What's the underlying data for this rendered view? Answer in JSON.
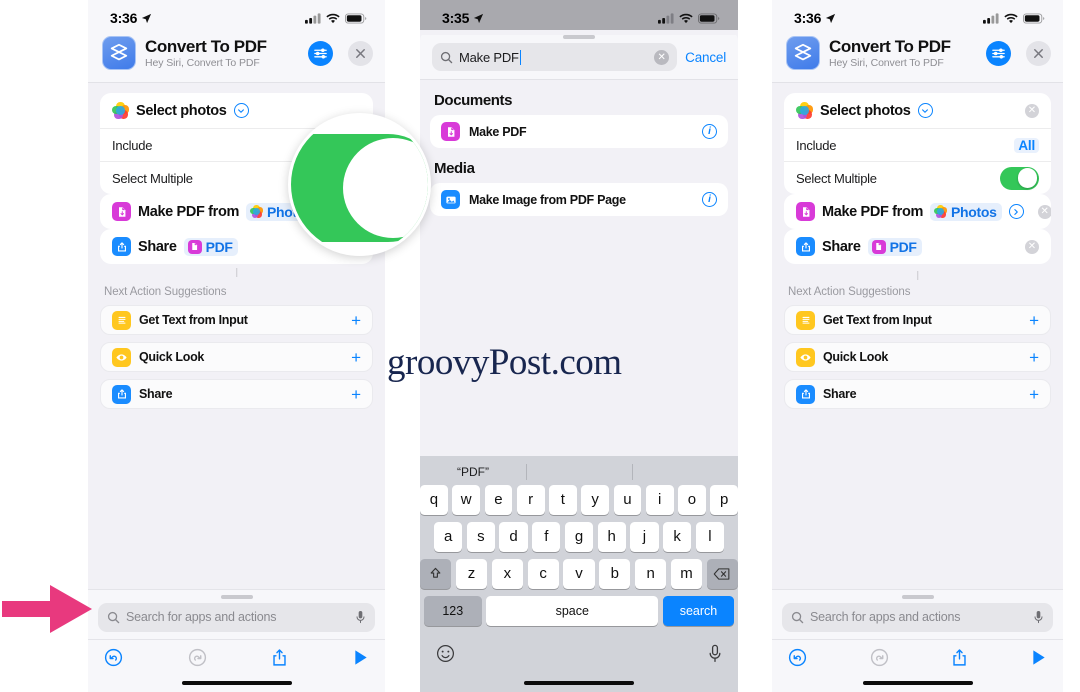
{
  "watermark": "groovyPost.com",
  "colors": {
    "accent_blue": "#0a84ff",
    "toggle_green": "#34c759",
    "magenta_tile": "#d83ad8",
    "yellow_tile": "#ffc71f",
    "arrow_pink": "#e8397e",
    "watermark_navy": "#18264f"
  },
  "panel1": {
    "status": {
      "time": "3:36",
      "location_icon": "location-arrow",
      "cellular_icon": "cellular-bars",
      "wifi_icon": "wifi",
      "battery_icon": "battery"
    },
    "header": {
      "app_icon": "shortcuts-icon",
      "title": "Convert To PDF",
      "subtitle": "Hey Siri, Convert To PDF",
      "settings_icon": "sliders-icon",
      "close_icon": "close-icon"
    },
    "actions": [
      {
        "icon": "photos-icon",
        "title": "Select photos",
        "chevron": "chevron-down-icon",
        "sub": [
          {
            "label": "Include",
            "value": ""
          },
          {
            "label": "Select Multiple",
            "value": ""
          }
        ]
      },
      {
        "icon": "make-pdf-icon",
        "title": "Make PDF from",
        "chip_icon": "photos-icon",
        "chip": "Photos"
      },
      {
        "icon": "share-icon",
        "title": "Share",
        "chip_icon": "make-pdf-icon",
        "chip": "PDF"
      }
    ],
    "suggestions_title": "Next Action Suggestions",
    "suggestions": [
      {
        "icon": "get-text-icon",
        "label": "Get Text from Input",
        "add": "+"
      },
      {
        "icon": "quick-look-icon",
        "label": "Quick Look",
        "add": "+"
      },
      {
        "icon": "share-icon",
        "label": "Share",
        "add": "+"
      }
    ],
    "dock": {
      "search_placeholder": "Search for apps and actions",
      "search_icon": "search-icon",
      "mic_icon": "microphone-icon",
      "undo_icon": "undo-icon",
      "redo_icon": "redo-icon",
      "share_icon": "share-up-icon",
      "play_icon": "play-icon"
    }
  },
  "panel2": {
    "status": {
      "time": "3:35",
      "location_icon": "location-arrow"
    },
    "search": {
      "icon": "search-icon",
      "value": "Make PDF",
      "clear_icon": "clear-icon",
      "cancel_label": "Cancel"
    },
    "sections": [
      {
        "heading": "Documents",
        "results": [
          {
            "icon": "make-pdf-icon",
            "label": "Make PDF",
            "info_icon": "info-icon"
          }
        ]
      },
      {
        "heading": "Media",
        "results": [
          {
            "icon": "make-image-icon",
            "label": "Make Image from PDF Page",
            "info_icon": "info-icon"
          }
        ]
      }
    ],
    "keyboard": {
      "predictions": [
        "“PDF”",
        "",
        ""
      ],
      "row1": [
        "q",
        "w",
        "e",
        "r",
        "t",
        "y",
        "u",
        "i",
        "o",
        "p"
      ],
      "row2": [
        "a",
        "s",
        "d",
        "f",
        "g",
        "h",
        "j",
        "k",
        "l"
      ],
      "row3": [
        "z",
        "x",
        "c",
        "v",
        "b",
        "n",
        "m"
      ],
      "shift_icon": "shift-icon",
      "backspace_icon": "backspace-icon",
      "numbers_key": "123",
      "space_key": "space",
      "return_key": "search",
      "emoji_icon": "emoji-icon",
      "dictation_icon": "microphone-icon"
    }
  },
  "panel3": {
    "status": {
      "time": "3:36",
      "location_icon": "location-arrow"
    },
    "header": {
      "app_icon": "shortcuts-icon",
      "title": "Convert To PDF",
      "subtitle": "Hey Siri, Convert To PDF",
      "settings_icon": "sliders-icon",
      "close_icon": "close-icon"
    },
    "actions": [
      {
        "icon": "photos-icon",
        "title": "Select photos",
        "chevron": "chevron-down-icon",
        "remove": "x",
        "sub": [
          {
            "label": "Include",
            "value": "All"
          },
          {
            "label": "Select Multiple",
            "toggle": "on"
          }
        ]
      },
      {
        "icon": "make-pdf-icon",
        "title": "Make PDF from",
        "chip_icon": "photos-icon",
        "chip": "Photos",
        "chevron": "chevron-right-icon",
        "remove": "x"
      },
      {
        "icon": "share-icon",
        "title": "Share",
        "chip_icon": "make-pdf-icon",
        "chip": "PDF",
        "remove": "x"
      }
    ],
    "suggestions_title": "Next Action Suggestions",
    "suggestions": [
      {
        "icon": "get-text-icon",
        "label": "Get Text from Input",
        "add": "+"
      },
      {
        "icon": "quick-look-icon",
        "label": "Quick Look",
        "add": "+"
      },
      {
        "icon": "share-icon",
        "label": "Share",
        "add": "+"
      }
    ],
    "dock": {
      "search_placeholder": "Search for apps and actions",
      "search_icon": "search-icon",
      "mic_icon": "microphone-icon"
    }
  }
}
